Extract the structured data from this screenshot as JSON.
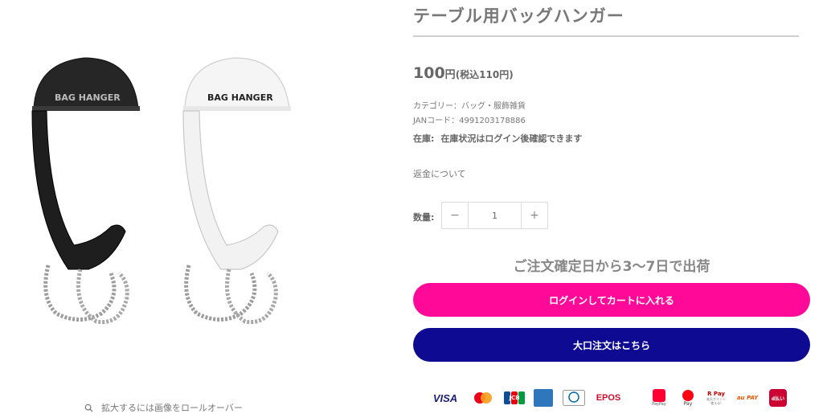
{
  "product": {
    "title": "テーブル用バッグハンガー",
    "price_num": "100",
    "price_unit": "円",
    "price_tax": "(税込110円)",
    "category": "カテゴリー：バッグ・服飾雑貨",
    "jan": "JANコード：4991203178886",
    "stock_label": "在庫:",
    "stock_value": "在庫状況はログイン後確認できます",
    "refund_link": "返金について",
    "qty_label": "数量:",
    "qty_value": "1",
    "qty_minus": "−",
    "qty_plus": "+",
    "shipping_note": "ご注文確定日から3〜7日で出荷",
    "cart_button": "ログインしてカートに入れる",
    "bulk_button": "大口注文はこちら"
  },
  "image": {
    "label_text": "BAG HANGER",
    "zoom_hint": "拡大するには画像をロールオーバー"
  },
  "payments": {
    "visa": "VISA",
    "jcb": "JCB",
    "epos": "EPOS",
    "paypay": "PayPay",
    "merpay": "Pay",
    "rakuten": "R Pay",
    "rakuten_sub": "楽天ポイント使える!",
    "aupay": "au PAY",
    "dbarai": "d払い"
  },
  "colors": {
    "cart": "#ff0a98",
    "bulk": "#0e0a91"
  }
}
